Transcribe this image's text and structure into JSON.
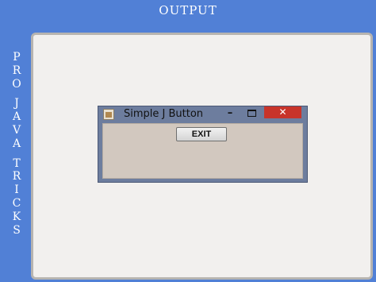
{
  "header": {
    "title": "OUTPUT"
  },
  "side_brand": {
    "words": [
      [
        "P",
        "R",
        "O"
      ],
      [
        "J",
        "A",
        "V",
        "A"
      ],
      [
        "T",
        "R",
        "I",
        "C",
        "K",
        "S"
      ]
    ]
  },
  "window": {
    "title": "Simple J Button",
    "minimize_glyph": "–",
    "close_glyph": "✕",
    "button_label": "EXIT"
  },
  "colors": {
    "background": "#5180d6",
    "panel": "#f2f0ee",
    "close_button": "#c8342a",
    "window_frame": "#6d7d9e",
    "content_area": "#d2c8bf"
  }
}
